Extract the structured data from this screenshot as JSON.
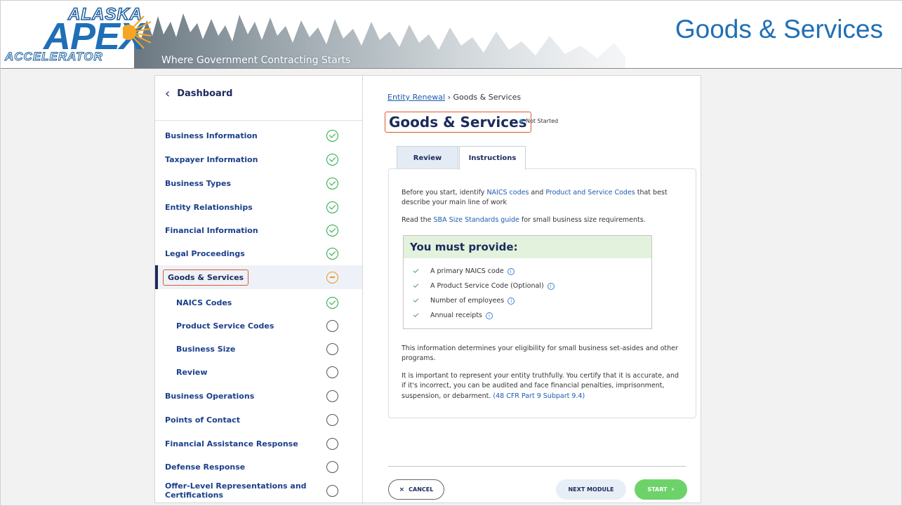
{
  "logo": {
    "line1": "ALASKA",
    "line2": "APEX",
    "line3": "ACCELERATOR"
  },
  "header": {
    "tagline": "Where Government Contracting Starts",
    "slide_title": "Goods & Services"
  },
  "sidebar": {
    "back_label": "Dashboard",
    "items": [
      {
        "label": "Business Information",
        "status": "complete"
      },
      {
        "label": "Taxpayer Information",
        "status": "complete"
      },
      {
        "label": "Business Types",
        "status": "complete"
      },
      {
        "label": "Entity Relationships",
        "status": "complete"
      },
      {
        "label": "Financial Information",
        "status": "complete"
      },
      {
        "label": "Legal Proceedings",
        "status": "complete"
      },
      {
        "label": "Goods & Services",
        "status": "in-progress"
      },
      {
        "label": "NAICS Codes",
        "status": "complete"
      },
      {
        "label": "Product Service Codes",
        "status": "not-started"
      },
      {
        "label": "Business Size",
        "status": "not-started"
      },
      {
        "label": "Review",
        "status": "not-started"
      },
      {
        "label": "Business Operations",
        "status": "not-started"
      },
      {
        "label": "Points of Contact",
        "status": "not-started"
      },
      {
        "label": "Financial Assistance Response",
        "status": "not-started"
      },
      {
        "label": "Defense Response",
        "status": "not-started"
      },
      {
        "label": "Offer-Level Representations and Certifications",
        "status": "not-started"
      }
    ]
  },
  "main": {
    "breadcrumb_link": "Entity Renewal",
    "breadcrumb_sep": "›",
    "breadcrumb_current": "Goods & Services",
    "title": "Goods & Services",
    "status": "Not Started",
    "tabs": [
      {
        "label": "Review"
      },
      {
        "label": "Instructions"
      }
    ],
    "intro_1": "Before you start, identify ",
    "link_naics": "NAICS codes",
    "intro_2": " and ",
    "link_psc": "Product and Service Codes",
    "intro_3": " that best describe your main line of work",
    "read_1": "Read the ",
    "link_sba": "SBA Size Standards guide",
    "read_2": " for small business size requirements.",
    "provide_heading": "You must provide:",
    "requirements": [
      {
        "label": "A primary NAICS code"
      },
      {
        "label": "A Product Service Code (Optional)"
      },
      {
        "label": "Number of employees"
      },
      {
        "label": "Annual receipts"
      }
    ],
    "eligibility": "This information determines your eligibility for small business set-asides and other programs.",
    "certify": "It is important to represent your entity truthfully. You certify that it is accurate, and if it's incorrect, you can be audited and face financial penalties, imprisonment, suspension, or debarment.",
    "cfr_link": "(48 CFR Part 9 Subpart 9.4)",
    "buttons": {
      "cancel": "CANCEL",
      "next": "NEXT MODULE",
      "start": "START"
    }
  },
  "colors": {
    "brand_blue": "#1f6fb6",
    "highlight": "#e0582a",
    "success": "#27a745",
    "start_button": "#6ed26a"
  }
}
